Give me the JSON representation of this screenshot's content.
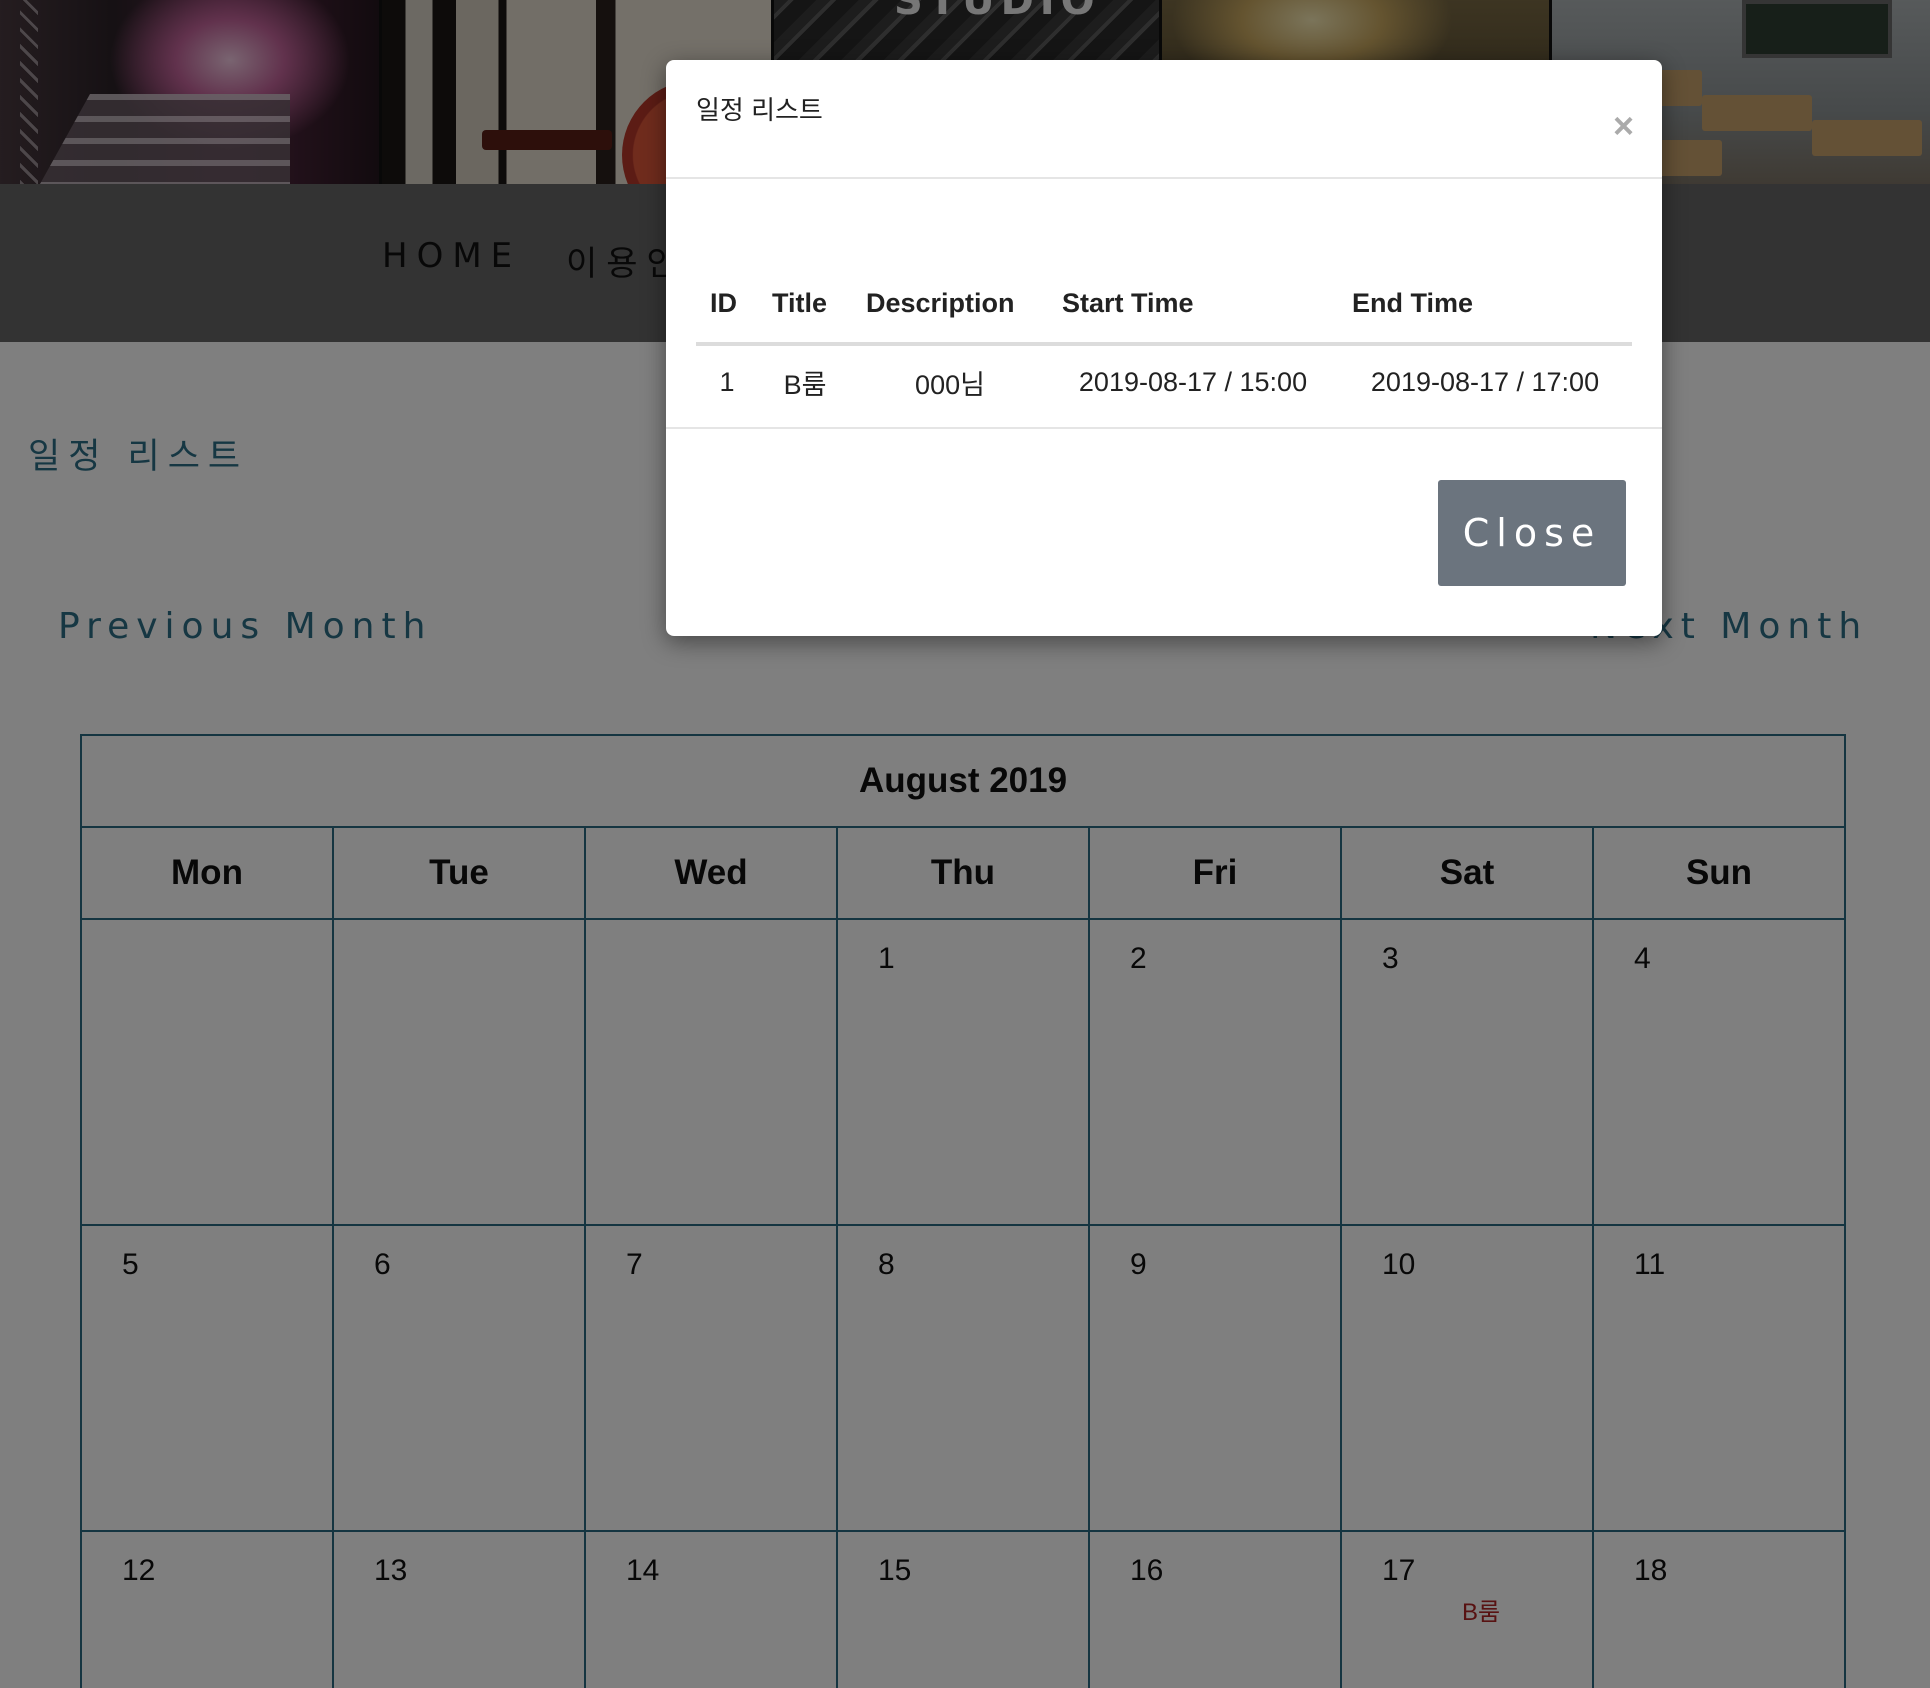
{
  "banner": {
    "sign_text": "STUDIO"
  },
  "nav": {
    "home": "HOME",
    "guide": "이용안"
  },
  "page": {
    "heading": "일정 리스트",
    "prev_month": "Previous Month",
    "next_month": "Next Month"
  },
  "calendar": {
    "title": "August 2019",
    "weekdays": [
      "Mon",
      "Tue",
      "Wed",
      "Thu",
      "Fri",
      "Sat",
      "Sun"
    ],
    "weeks": [
      [
        "",
        "",
        "",
        "1",
        "2",
        "3",
        "4"
      ],
      [
        "5",
        "6",
        "7",
        "8",
        "9",
        "10",
        "11"
      ],
      [
        "12",
        "13",
        "14",
        "15",
        "16",
        "17",
        "18"
      ]
    ],
    "event": {
      "day": "17",
      "label": "B룸",
      "color": "#b02525"
    }
  },
  "modal": {
    "title": "일정 리스트",
    "close_x": "×",
    "columns": [
      "ID",
      "Title",
      "Description",
      "Start Time",
      "End Time"
    ],
    "rows": [
      {
        "id": "1",
        "title": "B룸",
        "description": "000님",
        "start": "2019-08-17 / 15:00",
        "end": "2019-08-17 / 17:00"
      }
    ],
    "close_button": "Close"
  },
  "colors": {
    "accent": "#2d6f86",
    "close_button": "#6b747e",
    "nav_bg": "#666666"
  }
}
